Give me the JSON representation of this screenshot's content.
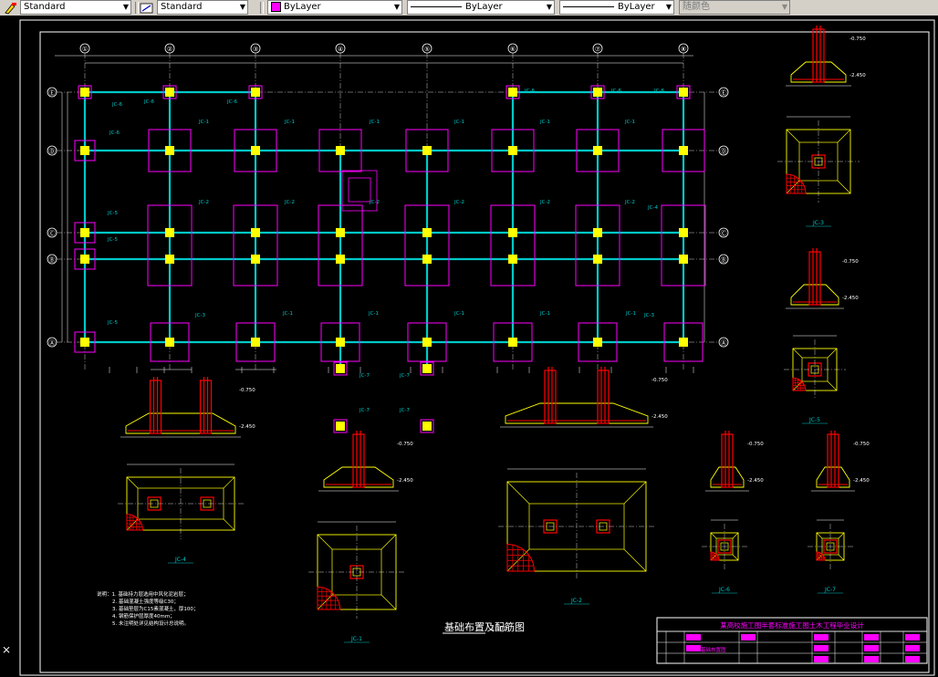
{
  "toolbar": {
    "text_style": "Standard",
    "dim_style": "Standard",
    "layer_color": "ByLayer",
    "linetype": "ByLayer",
    "lineweight": "ByLayer",
    "plot_style": "随颜色"
  },
  "drawing": {
    "axis_columns": [
      "①",
      "②",
      "③",
      "④",
      "⑤",
      "⑥",
      "⑦",
      "⑧"
    ],
    "axis_rows": [
      "Ⓔ",
      "Ⓓ",
      "Ⓒ",
      "Ⓑ",
      "Ⓐ"
    ],
    "plan_title": "基础布置及配筋图",
    "plan_scale": "1:100",
    "footing_labels": [
      "JC-1",
      "JC-2",
      "JC-3",
      "JC-4",
      "JC-5",
      "JC-6",
      "JC-7"
    ],
    "notes": [
      "说明：1. 基础持力层选用中风化泥岩层；",
      "2. 基础混凝土强度等级C30；",
      "3. 基础垫层为C15素混凝土，厚100；",
      "4. 钢筋保护层厚度40mm；",
      "5. 未注明处详见结构设计总说明。"
    ],
    "title_block": {
      "project": "某高校施工图半套标准施工图土木工程毕业设计",
      "drawing_name": "基础布置图"
    },
    "detail_titles": [
      "JC-1",
      "JC-2",
      "JC-3",
      "JC-4",
      "JC-5",
      "JC-6",
      "JC-7"
    ],
    "elevations": [
      "-0.750",
      "-2.450",
      "-1.850",
      "-2.150"
    ]
  },
  "colors": {
    "background": "#000000",
    "axis_line": "#00c8c8",
    "footing": "#ff00ff",
    "column": "#ffff00",
    "rebar": "#ff0000",
    "border": "#ffffff",
    "title_block": "#ff00ff"
  }
}
